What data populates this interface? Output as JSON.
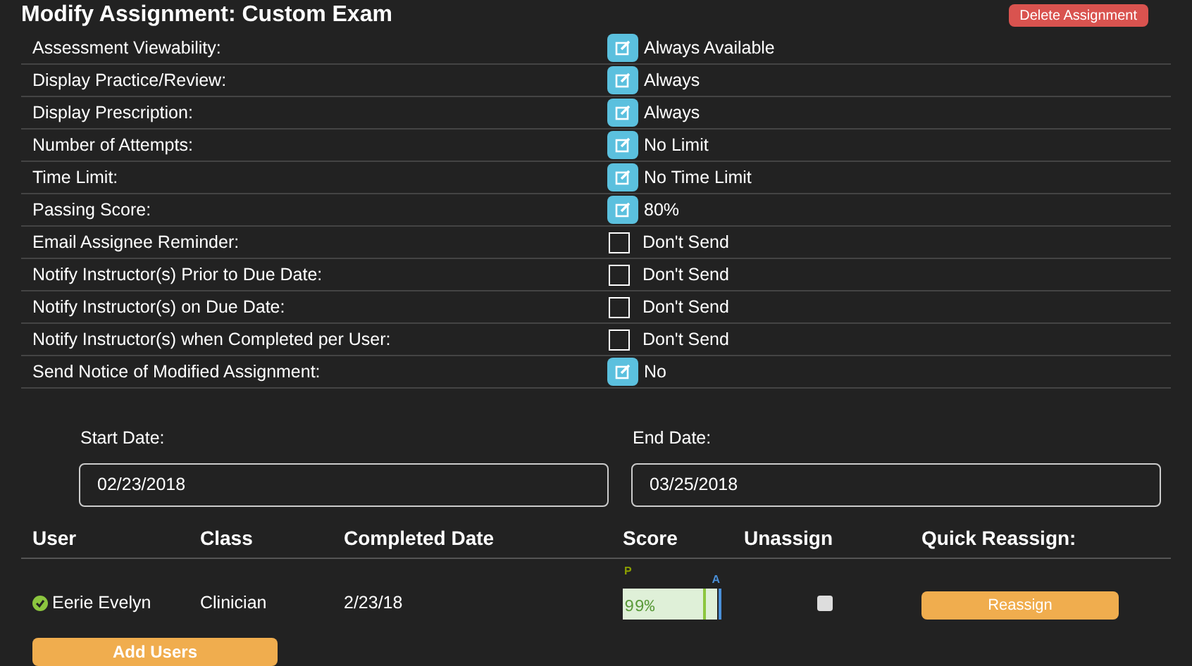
{
  "title": "Modify Assignment: Custom Exam",
  "delete_button": "Delete Assignment",
  "settings": [
    {
      "label": "Assessment Viewability:",
      "kind": "edit",
      "value": "Always Available"
    },
    {
      "label": "Display Practice/Review:",
      "kind": "edit",
      "value": "Always"
    },
    {
      "label": "Display Prescription:",
      "kind": "edit",
      "value": "Always"
    },
    {
      "label": "Number of Attempts:",
      "kind": "edit",
      "value": "No Limit"
    },
    {
      "label": "Time Limit:",
      "kind": "edit",
      "value": "No Time Limit"
    },
    {
      "label": "Passing Score:",
      "kind": "edit",
      "value": "80%"
    },
    {
      "label": "Email Assignee Reminder:",
      "kind": "checkbox",
      "checked": false,
      "value": "Don't Send"
    },
    {
      "label": "Notify Instructor(s) Prior to Due Date:",
      "kind": "checkbox",
      "checked": false,
      "value": "Don't Send"
    },
    {
      "label": "Notify Instructor(s) on Due Date:",
      "kind": "checkbox",
      "checked": false,
      "value": "Don't Send"
    },
    {
      "label": "Notify Instructor(s) when Completed per User:",
      "kind": "checkbox",
      "checked": false,
      "value": "Don't Send"
    },
    {
      "label": "Send Notice of Modified Assignment:",
      "kind": "edit",
      "value": "No"
    }
  ],
  "start_date": {
    "label": "Start Date:",
    "value": "02/23/2018"
  },
  "end_date": {
    "label": "End Date:",
    "value": "03/25/2018"
  },
  "table": {
    "columns": [
      "User",
      "Class",
      "Completed Date",
      "Score",
      "Unassign",
      "Quick Reassign:"
    ],
    "rows": [
      {
        "user": "Eerie Evelyn",
        "completed": true,
        "class": "Clinician",
        "date": "2/23/18",
        "score": "99%",
        "level": 0.99,
        "pass_mark": "P",
        "avg_mark": "A",
        "unassign": false,
        "reassign": "Reassign"
      }
    ]
  },
  "add_users_button": "Add Users"
}
